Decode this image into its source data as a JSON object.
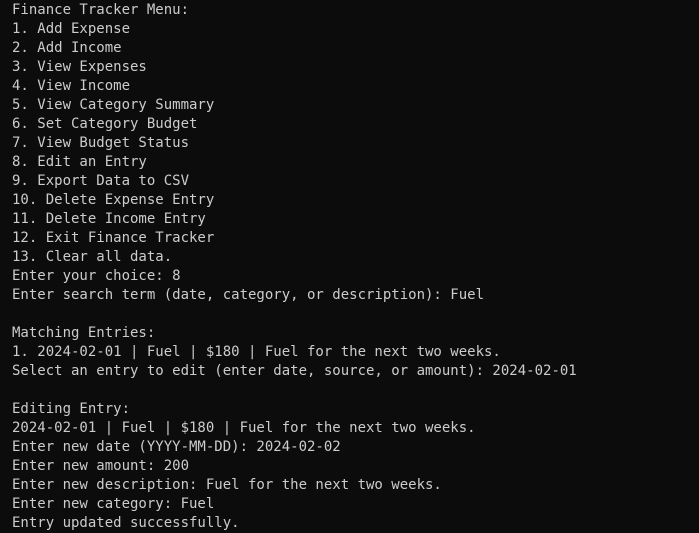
{
  "terminal": {
    "lines": [
      "Finance Tracker Menu:",
      "1. Add Expense",
      "2. Add Income",
      "3. View Expenses",
      "4. View Income",
      "5. View Category Summary",
      "6. Set Category Budget",
      "7. View Budget Status",
      "8. Edit an Entry",
      "9. Export Data to CSV",
      "10. Delete Expense Entry",
      "11. Delete Income Entry",
      "12. Exit Finance Tracker",
      "13. Clear all data.",
      "Enter your choice: 8",
      "Enter search term (date, category, or description): Fuel",
      "",
      "Matching Entries:",
      "1. 2024-02-01 | Fuel | $180 | Fuel for the next two weeks.",
      "Select an entry to edit (enter date, source, or amount): 2024-02-01",
      "",
      "Editing Entry:",
      "2024-02-01 | Fuel | $180 | Fuel for the next two weeks.",
      "Enter new date (YYYY-MM-DD): 2024-02-02",
      "Enter new amount: 200",
      "Enter new description: Fuel for the next two weeks.",
      "Enter new category: Fuel",
      "Entry updated successfully."
    ]
  },
  "colors": {
    "background": "#0c0c0c",
    "foreground": "#cccccc"
  }
}
